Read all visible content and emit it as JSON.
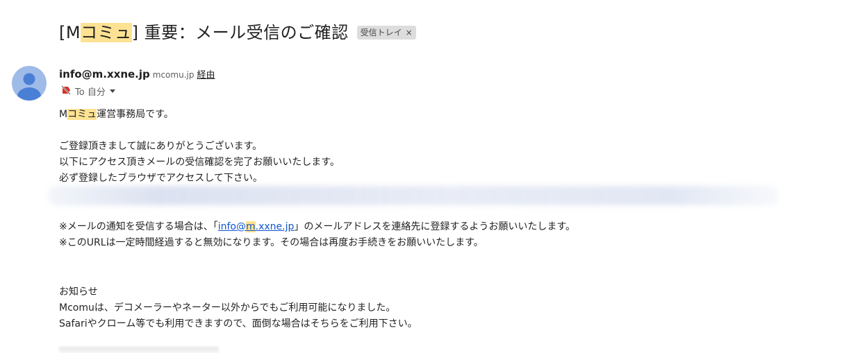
{
  "subject": {
    "bracket_open": "[M",
    "highlight": "コミュ",
    "rest": "] 重要：メール受信のご確認"
  },
  "label_chip": {
    "text": "受信トレイ",
    "close": "×"
  },
  "sender": {
    "email": "info@m.xxne.jp",
    "via_domain": "mcomu.jp",
    "via_label": "経由"
  },
  "recipient": {
    "text": "To 自分"
  },
  "body": {
    "intro": {
      "prefix": "M",
      "highlight": "コミュ",
      "suffix": "運営事務局です。"
    },
    "paragraph1": [
      "ご登録頂きまして誠にありがとうございます。",
      "以下にアクセス頂きメールの受信確認を完了お願いいたします。",
      "必ず登録したブラウザでアクセスして下さい。"
    ],
    "notice": {
      "prefix": "※メールの通知を受信する場合は、「",
      "link_before": "info@",
      "link_highlight": "m",
      "link_after": ".xxne.jp",
      "suffix": "」のメールアドレスを連絡先に登録するようお願いいたします。"
    },
    "url_notice": "※このURLは一定時間経過すると無効になります。その場合は再度お手続きをお願いいたします。",
    "announcement": [
      "お知らせ",
      "Mcomuは、デコメーラーやネーター以外からでもご利用可能になりました。",
      "Safariやクローム等でも利用できますので、面倒な場合はそちらをご利用下さい。"
    ]
  },
  "icons": {
    "avatar": "default-user-avatar",
    "important_marker": "important-off-icon",
    "caret": "chevron-down-icon"
  },
  "colors": {
    "highlight": "#fde293",
    "link": "#1155cc",
    "avatar_bg": "#9fbbe8",
    "avatar_fg": "#4a7fd6",
    "important_red": "#d93025"
  }
}
